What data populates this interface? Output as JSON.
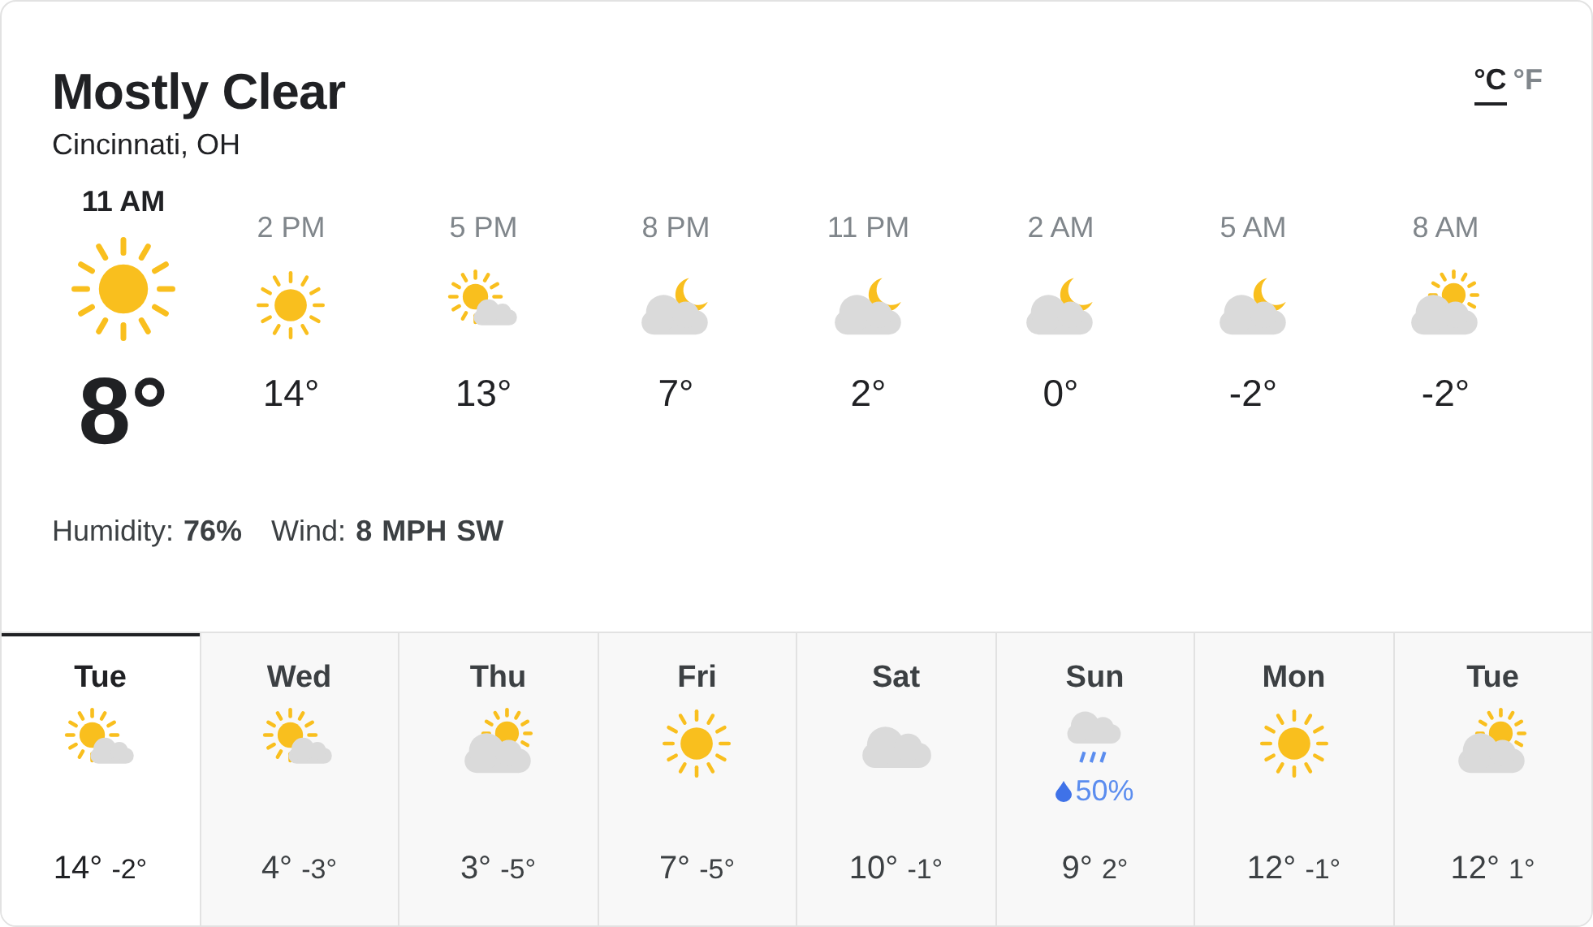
{
  "condition": "Mostly Clear",
  "location": "Cincinnati, OH",
  "units": [
    {
      "label": "°C",
      "selected": true
    },
    {
      "label": "°F",
      "selected": false
    }
  ],
  "current": {
    "time": "11 AM",
    "kind": "sun",
    "temp": "8°"
  },
  "hourly": [
    {
      "time": "2 PM",
      "kind": "sun",
      "temp": "14°"
    },
    {
      "time": "5 PM",
      "kind": "partlysunny",
      "temp": "13°"
    },
    {
      "time": "8 PM",
      "kind": "night",
      "temp": "7°"
    },
    {
      "time": "11 PM",
      "kind": "night",
      "temp": "2°"
    },
    {
      "time": "2 AM",
      "kind": "night",
      "temp": "0°"
    },
    {
      "time": "5 AM",
      "kind": "night",
      "temp": "-2°"
    },
    {
      "time": "8 AM",
      "kind": "mostlycloudy",
      "temp": "-2°"
    }
  ],
  "details": "Humidity: **76%**   Wind: **8 MPH SW**",
  "daily": [
    {
      "day": "Tue",
      "kind": "partlysunny",
      "high": "14°",
      "low": "-2°",
      "selected": true
    },
    {
      "day": "Wed",
      "kind": "partlysunny",
      "high": "4°",
      "low": "-3°",
      "selected": false
    },
    {
      "day": "Thu",
      "kind": "mostlycloudy",
      "high": "3°",
      "low": "-5°",
      "selected": false
    },
    {
      "day": "Fri",
      "kind": "sun",
      "high": "7°",
      "low": "-5°",
      "selected": false
    },
    {
      "day": "Sat",
      "kind": "cloudy",
      "high": "10°",
      "low": "-1°",
      "selected": false
    },
    {
      "day": "Sun",
      "kind": "rain",
      "precip": "50%",
      "high": "9°",
      "low": "2°",
      "selected": false
    },
    {
      "day": "Mon",
      "kind": "sun",
      "high": "12°",
      "low": "-1°",
      "selected": false
    },
    {
      "day": "Tue",
      "kind": "mostlycloudy",
      "high": "12°",
      "low": "1°",
      "selected": false
    }
  ]
}
